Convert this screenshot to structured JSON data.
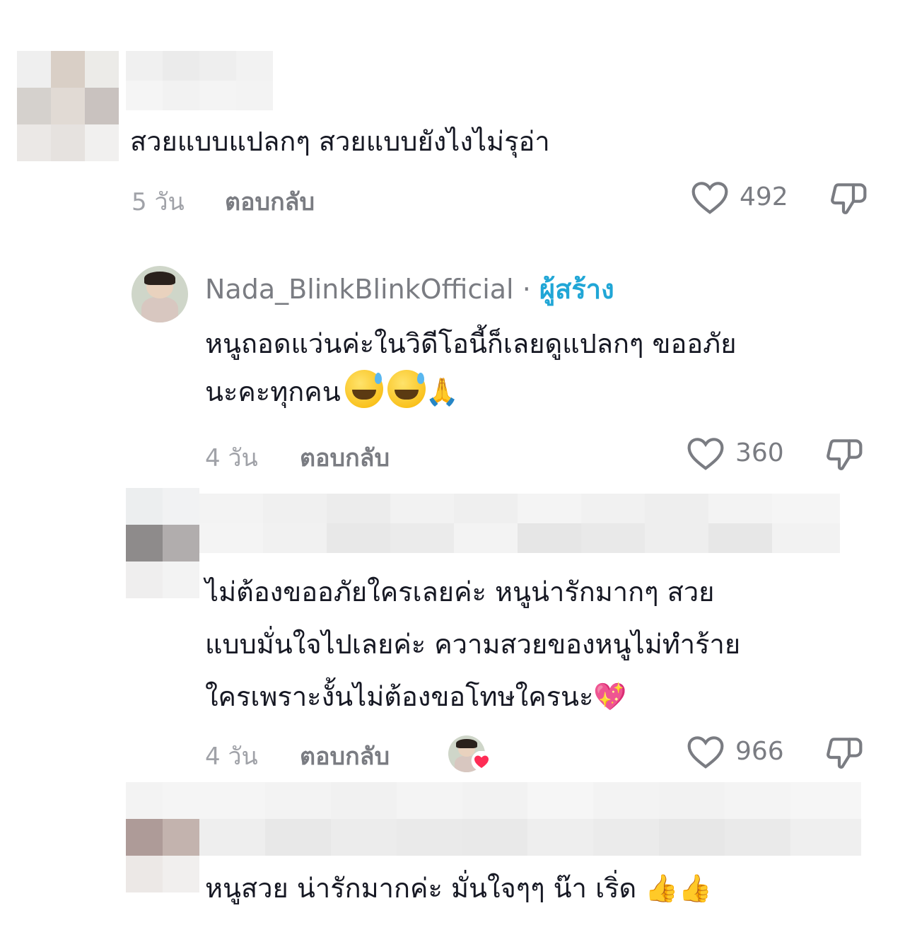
{
  "comments": [
    {
      "text": "สวยแบบแปลกๆ สวยแบบยังไงไม่รุอ่า",
      "time": "5 วัน",
      "reply_label": "ตอบกลับ",
      "likes": "492"
    },
    {
      "username": "Nada_BlinkBlinkOfficial",
      "separator": "·",
      "creator_badge": "ผู้สร้าง",
      "text_line1": "หนูถอดแว่นค่ะในวิดีโอนี้ก็เลยดูแปลกๆ ขออภัย",
      "text_line2": "นะคะทุกคน",
      "emoji": "🙏",
      "time": "4 วัน",
      "reply_label": "ตอบกลับ",
      "likes": "360"
    },
    {
      "text_line1": "ไม่ต้องขออภัยใครเลยค่ะ หนูน่ารักมากๆ สวย",
      "text_line2": "แบบมั่นใจไปเลยค่ะ ความสวยของหนูไม่ทำร้าย",
      "text_line3": "ใครเพราะงั้นไม่ต้องขอโทษใครนะ",
      "emoji": "💖",
      "time": "4 วัน",
      "reply_label": "ตอบกลับ",
      "likes": "966"
    },
    {
      "text": "หนูสวย น่ารักมากค่ะ มั่นใจๆๆ น๊า เริ่ด",
      "emoji": "👍👍"
    }
  ],
  "icons": {
    "like": "heart-outline-icon",
    "dislike": "thumbs-down-outline-icon",
    "creator_liked": "heart-badge-icon"
  },
  "colors": {
    "text": "#161823",
    "muted": "#a0a2a8",
    "creator": "#20a6d6",
    "heart_badge": "#fe2c55"
  }
}
